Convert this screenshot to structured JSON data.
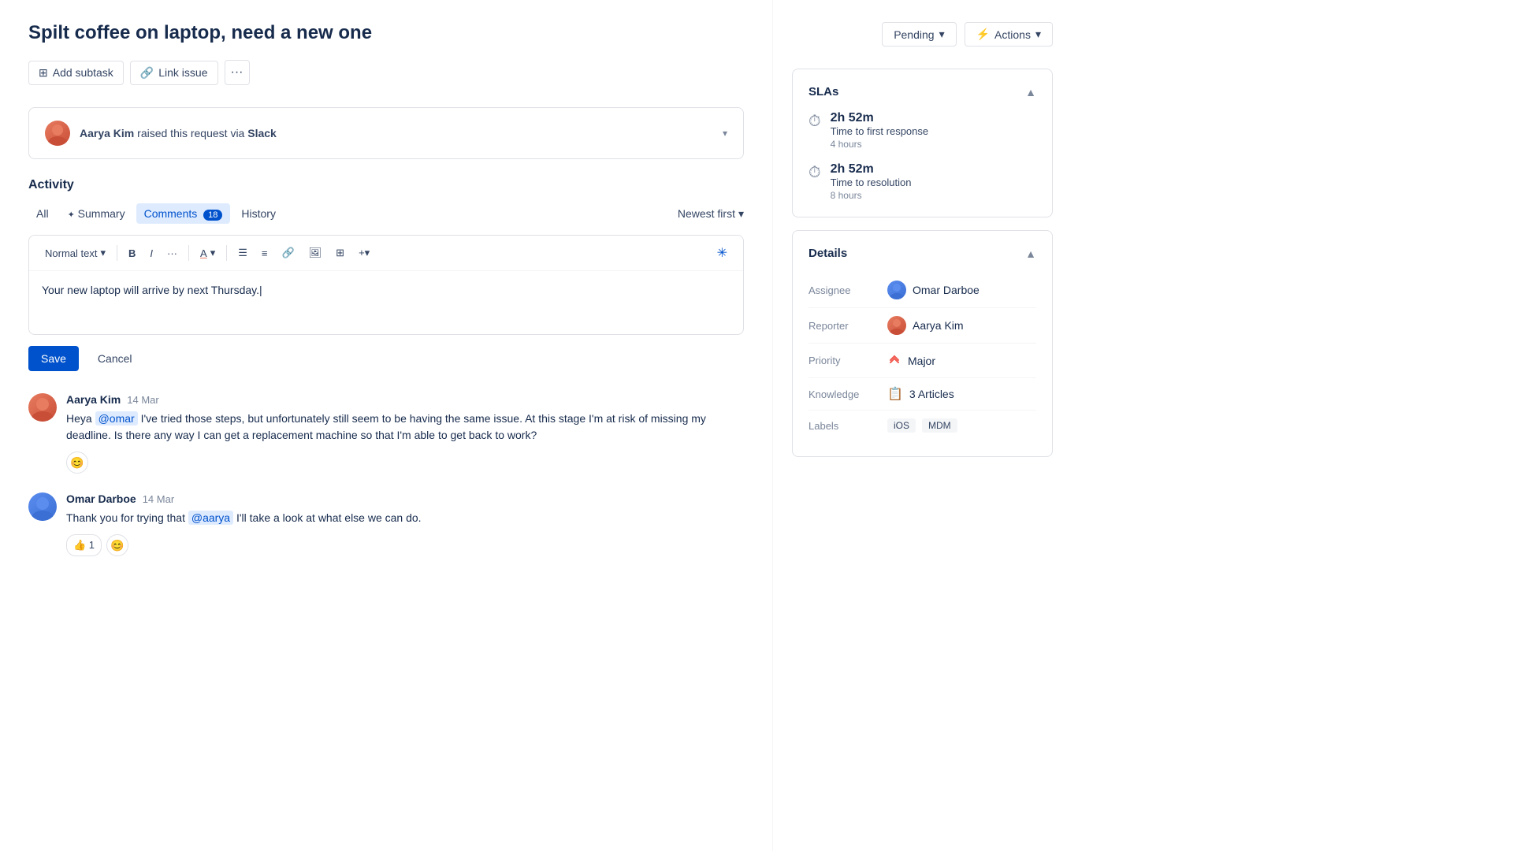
{
  "page": {
    "title": "Spilt coffee on laptop, need a new one"
  },
  "toolbar": {
    "add_subtask_label": "Add subtask",
    "link_issue_label": "Link issue",
    "more_icon": "···"
  },
  "request_banner": {
    "user": "Aarya Kim",
    "text": "raised this request via",
    "source": "Slack"
  },
  "activity": {
    "title": "Activity",
    "tabs": [
      {
        "id": "all",
        "label": "All",
        "active": false
      },
      {
        "id": "summary",
        "label": "Summary",
        "active": false,
        "icon": "✦"
      },
      {
        "id": "comments",
        "label": "Comments",
        "active": true,
        "badge": "18"
      },
      {
        "id": "history",
        "label": "History",
        "active": false
      }
    ],
    "sort_label": "Newest first"
  },
  "editor": {
    "text_format": "Normal text",
    "content": "Your new laptop will arrive by next Thursday.",
    "save_label": "Save",
    "cancel_label": "Cancel"
  },
  "comments": [
    {
      "id": 1,
      "author": "Aarya Kim",
      "date": "14 Mar",
      "text_parts": [
        {
          "type": "text",
          "value": "Heya "
        },
        {
          "type": "mention",
          "value": "@omar"
        },
        {
          "type": "text",
          "value": " I've tried those steps, but unfortunately still seem to be having the same issue. At this stage I'm at risk of missing my deadline. Is there any way I can get a replacement machine so that I'm able to get back to work?"
        }
      ],
      "reactions": [
        {
          "emoji": "😊",
          "count": null
        }
      ]
    },
    {
      "id": 2,
      "author": "Omar Darboe",
      "date": "14 Mar",
      "text_parts": [
        {
          "type": "text",
          "value": "Thank you for trying that "
        },
        {
          "type": "mention",
          "value": "@aarya"
        },
        {
          "type": "text",
          "value": " I'll take a look at what else we can do."
        }
      ],
      "reactions": [
        {
          "emoji": "👍",
          "count": "1"
        },
        {
          "emoji": "😊",
          "count": null
        }
      ]
    }
  ],
  "sidebar": {
    "status": {
      "label": "Pending",
      "chevron": "▾"
    },
    "actions": {
      "label": "Actions",
      "icon": "⚡",
      "chevron": "▾"
    },
    "slas": {
      "title": "SLAs",
      "items": [
        {
          "time": "2h 52m",
          "label": "Time to first response",
          "hours": "4 hours"
        },
        {
          "time": "2h 52m",
          "label": "Time to resolution",
          "hours": "8 hours"
        }
      ]
    },
    "details": {
      "title": "Details",
      "rows": [
        {
          "label": "Assignee",
          "value": "Omar Darboe",
          "type": "user"
        },
        {
          "label": "Reporter",
          "value": "Aarya Kim",
          "type": "user"
        },
        {
          "label": "Priority",
          "value": "Major",
          "type": "priority"
        },
        {
          "label": "Knowledge",
          "value": "3 Articles",
          "type": "knowledge"
        },
        {
          "label": "Labels",
          "value": [
            "iOS",
            "MDM"
          ],
          "type": "labels"
        }
      ]
    }
  }
}
